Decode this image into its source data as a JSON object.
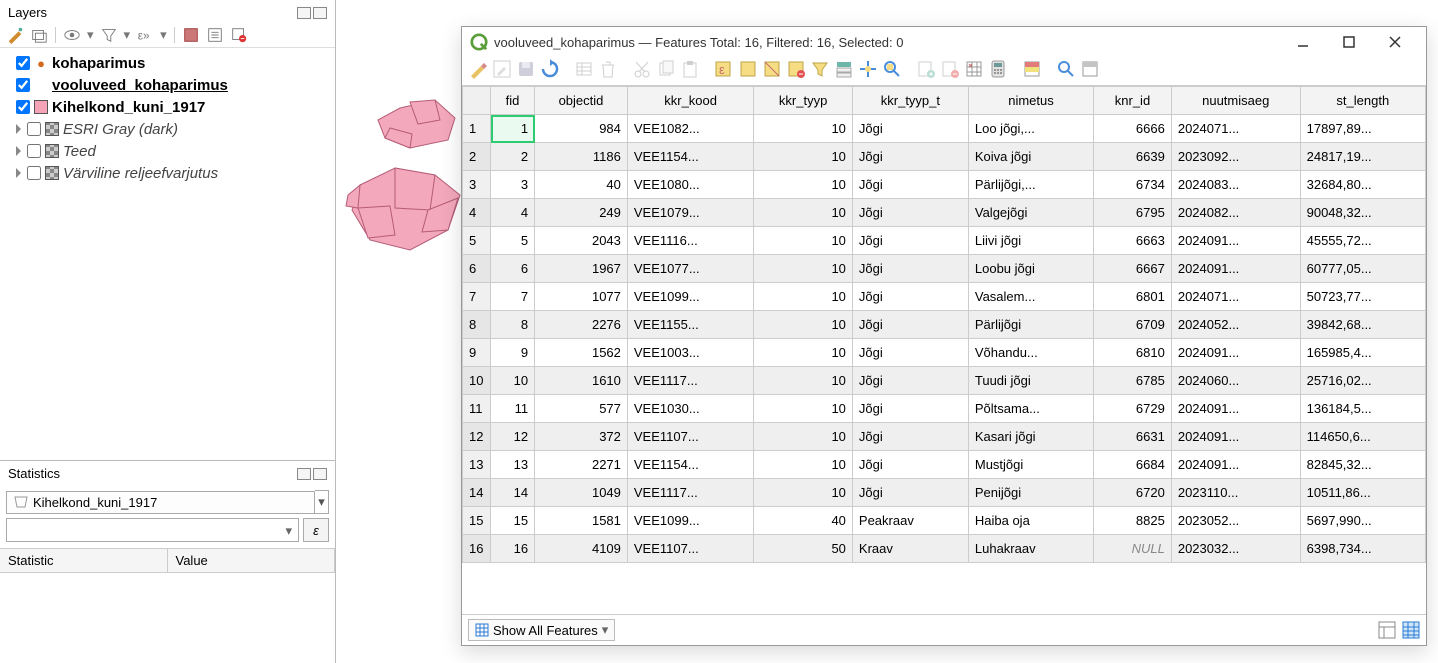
{
  "layers_panel": {
    "title": "Layers",
    "items": [
      {
        "checked": true,
        "swatch": "#d2691e",
        "swatch_type": "dot",
        "label": "kohaparimus",
        "style": "bold"
      },
      {
        "checked": true,
        "swatch": "",
        "swatch_type": "none",
        "label": "vooluveed_kohaparimus",
        "style": "underline"
      },
      {
        "checked": true,
        "swatch": "#f5a3b7",
        "swatch_type": "box",
        "label": "Kihelkond_kuni_1917",
        "style": "bold"
      },
      {
        "checked": false,
        "swatch": "checker",
        "swatch_type": "checker",
        "label": "ESRI Gray (dark)",
        "style": "italic",
        "expandable": true
      },
      {
        "checked": false,
        "swatch": "checker",
        "swatch_type": "checker",
        "label": "Teed",
        "style": "italic",
        "expandable": true
      },
      {
        "checked": false,
        "swatch": "checker",
        "swatch_type": "checker",
        "label": "Värviline reljeefvarjutus",
        "style": "italic",
        "expandable": true
      }
    ]
  },
  "stats_panel": {
    "title": "Statistics",
    "selected_layer": "Kihelkond_kuni_1917",
    "epsilon": "ε",
    "col_stat": "Statistic",
    "col_val": "Value"
  },
  "attr_window": {
    "title": "vooluveed_kohaparimus — Features Total: 16, Filtered: 16, Selected: 0",
    "columns": [
      "fid",
      "objectid",
      "kkr_kood",
      "kkr_tyyp",
      "kkr_tyyp_t",
      "nimetus",
      "knr_id",
      "nuutmisaeg",
      "st_length"
    ],
    "col_align": [
      "num",
      "num",
      "txt",
      "num",
      "txt",
      "txt",
      "num",
      "txt",
      "txt"
    ],
    "rows": [
      [
        "1",
        "984",
        "VEE1082...",
        "10",
        "Jõgi",
        "Loo jõgi,...",
        "6666",
        "2024071...",
        "17897,89..."
      ],
      [
        "2",
        "1186",
        "VEE1154...",
        "10",
        "Jõgi",
        "Koiva jõgi",
        "6639",
        "2023092...",
        "24817,19..."
      ],
      [
        "3",
        "40",
        "VEE1080...",
        "10",
        "Jõgi",
        "Pärlijõgi,...",
        "6734",
        "2024083...",
        "32684,80..."
      ],
      [
        "4",
        "249",
        "VEE1079...",
        "10",
        "Jõgi",
        "Valgejõgi",
        "6795",
        "2024082...",
        "90048,32..."
      ],
      [
        "5",
        "2043",
        "VEE1116...",
        "10",
        "Jõgi",
        "Liivi jõgi",
        "6663",
        "2024091...",
        "45555,72..."
      ],
      [
        "6",
        "1967",
        "VEE1077...",
        "10",
        "Jõgi",
        "Loobu jõgi",
        "6667",
        "2024091...",
        "60777,05..."
      ],
      [
        "7",
        "1077",
        "VEE1099...",
        "10",
        "Jõgi",
        "Vasalem...",
        "6801",
        "2024071...",
        "50723,77..."
      ],
      [
        "8",
        "2276",
        "VEE1155...",
        "10",
        "Jõgi",
        "Pärlijõgi",
        "6709",
        "2024052...",
        "39842,68..."
      ],
      [
        "9",
        "1562",
        "VEE1003...",
        "10",
        "Jõgi",
        "Võhandu...",
        "6810",
        "2024091...",
        "165985,4..."
      ],
      [
        "10",
        "1610",
        "VEE1117...",
        "10",
        "Jõgi",
        "Tuudi jõgi",
        "6785",
        "2024060...",
        "25716,02..."
      ],
      [
        "11",
        "577",
        "VEE1030...",
        "10",
        "Jõgi",
        "Põltsama...",
        "6729",
        "2024091...",
        "136184,5..."
      ],
      [
        "12",
        "372",
        "VEE1107...",
        "10",
        "Jõgi",
        "Kasari jõgi",
        "6631",
        "2024091...",
        "114650,6..."
      ],
      [
        "13",
        "2271",
        "VEE1154...",
        "10",
        "Jõgi",
        "Mustjõgi",
        "6684",
        "2024091...",
        "82845,32..."
      ],
      [
        "14",
        "1049",
        "VEE1117...",
        "10",
        "Jõgi",
        "Penijõgi",
        "6720",
        "2023110...",
        "10511,86..."
      ],
      [
        "15",
        "1581",
        "VEE1099...",
        "40",
        "Peakraav",
        "Haiba oja",
        "8825",
        "2023052...",
        "5697,990..."
      ],
      [
        "16",
        "4109",
        "VEE1107...",
        "50",
        "Kraav",
        "Luhakraav",
        "NULL",
        "2023032...",
        "6398,734..."
      ]
    ],
    "footer_btn": "Show All Features"
  }
}
